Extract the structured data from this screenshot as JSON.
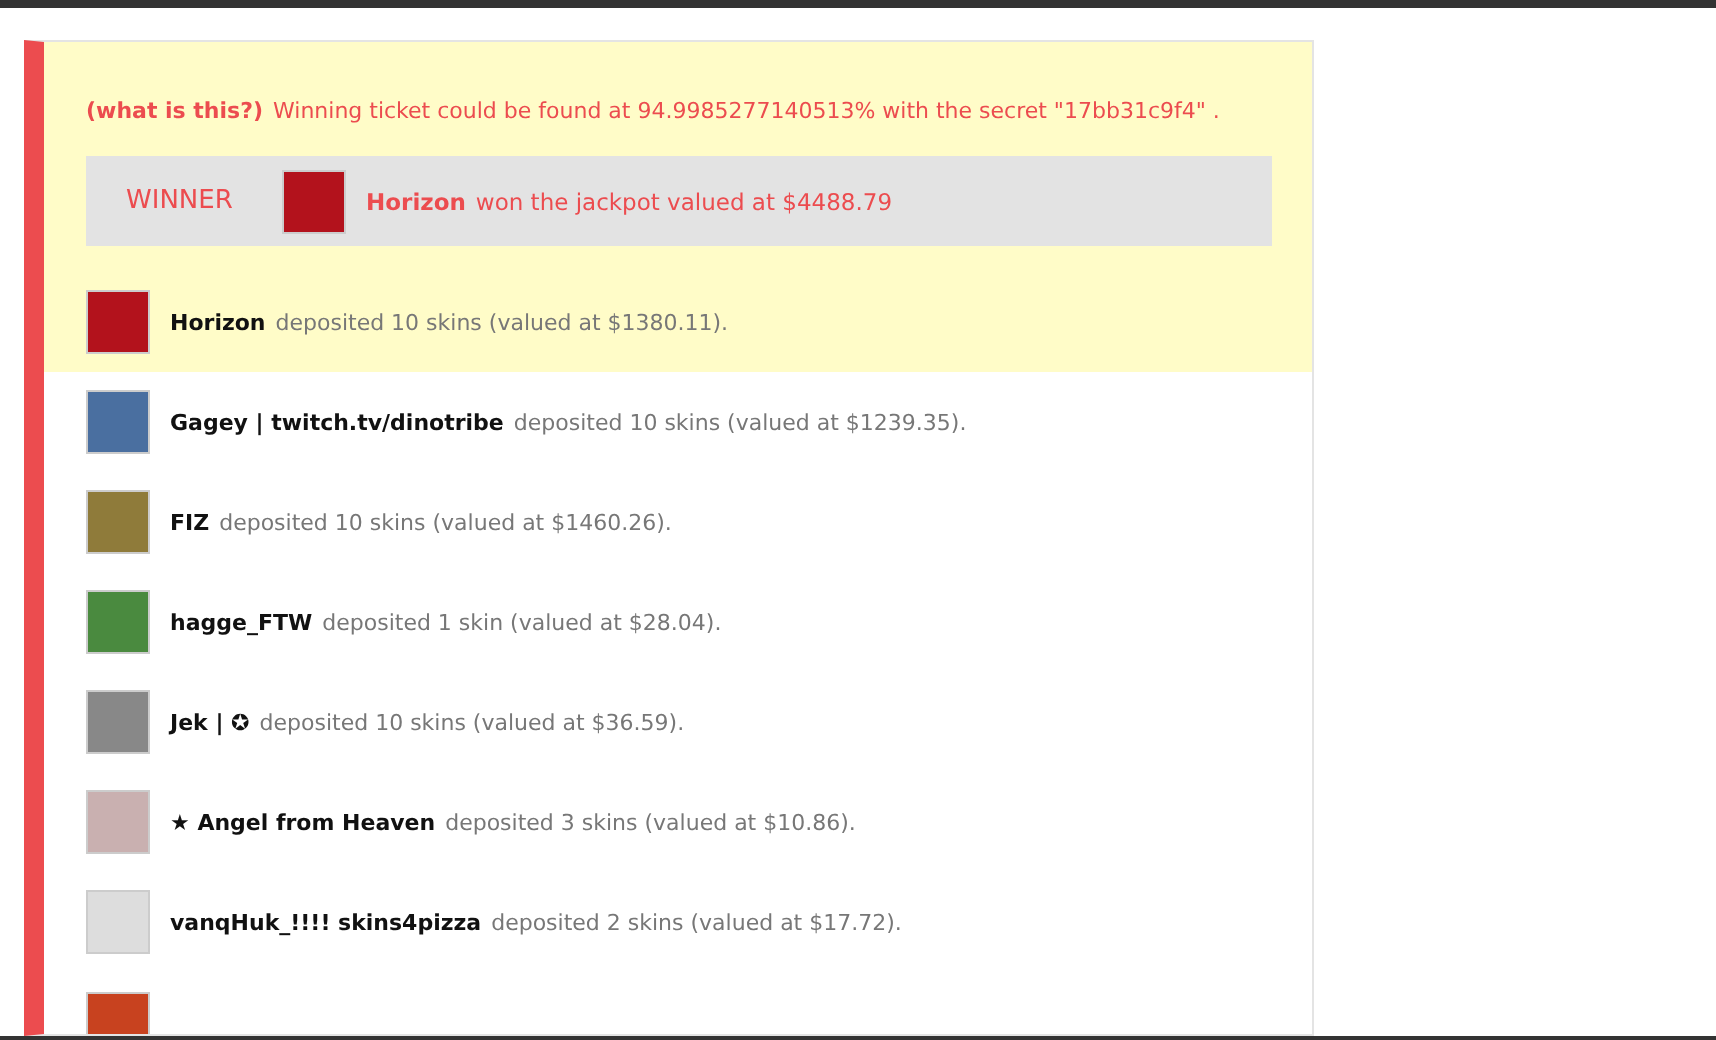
{
  "round": {
    "info_link": "(what is this?)",
    "verification": "Winning ticket could be found at 94.9985277140513% with the secret \"17bb31c9f4\" .",
    "winner": {
      "label": "WINNER",
      "name": "Horizon",
      "text": "won the jackpot valued at $4488.79"
    }
  },
  "deposits": [
    {
      "name": "Horizon",
      "text": "deposited 10 skins (valued at $1380.11).",
      "highlighted": true
    },
    {
      "name": "Gagey | twitch.tv/dinotribe",
      "text": "deposited 10 skins (valued at $1239.35).",
      "highlighted": false
    },
    {
      "name": "FIZ",
      "text": "deposited 10 skins (valued at $1460.26).",
      "highlighted": false
    },
    {
      "name": "hagge_FTW",
      "text": "deposited 1 skin (valued at $28.04).",
      "highlighted": false
    },
    {
      "name": "Jek | ✪",
      "text": "deposited 10 skins (valued at $36.59).",
      "highlighted": false
    },
    {
      "name": "★ Angel from Heaven",
      "text": "deposited 3 skins (valued at $10.86).",
      "highlighted": false
    },
    {
      "name": "vanqHuk_!!!! skins4pizza",
      "text": "deposited 2 skins (valued at $17.72).",
      "highlighted": false
    }
  ],
  "more_below": true
}
